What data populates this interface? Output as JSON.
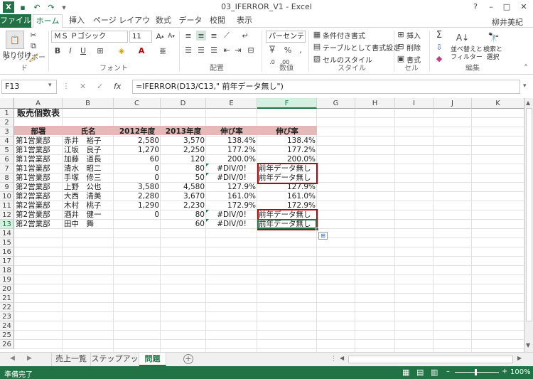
{
  "window": {
    "title": "03_IFERROR_V1 - Excel",
    "user": "柳井美紀"
  },
  "qat": {
    "save": "💾",
    "undo": "↶",
    "redo": "↷"
  },
  "tabs": [
    "ファイル",
    "ホーム",
    "挿入",
    "ページ レイアウト",
    "数式",
    "データ",
    "校閲",
    "表示"
  ],
  "ribbon": {
    "paste": "貼り付け",
    "clipboard_label": "クリップボード",
    "font_name": "ＭＳ Ｐゴシック",
    "font_size": "11",
    "font_label": "フォント",
    "align_label": "配置",
    "number_format": "パーセンテー",
    "number_label": "数値",
    "cond_format": "条件付き書式",
    "table_format": "テーブルとして書式設定",
    "cell_style": "セルのスタイル",
    "style_label": "スタイル",
    "insert": "挿入",
    "delete": "削除",
    "format": "書式",
    "cells_label": "セル",
    "sort_filter": "並べ替えと\nフィルター",
    "find_select": "検索と\n選択",
    "edit_label": "編集"
  },
  "formula_bar": {
    "name": "F13",
    "formula": "=IFERROR(D13/C13,\" 前年データ無し\")",
    "fx": "fx"
  },
  "columns": [
    "A",
    "B",
    "C",
    "D",
    "E",
    "F",
    "G",
    "H",
    "I",
    "J",
    "K"
  ],
  "rows": [
    "1",
    "2",
    "3",
    "4",
    "5",
    "6",
    "7",
    "8",
    "9",
    "10",
    "11",
    "12",
    "13",
    "14",
    "15",
    "16",
    "17",
    "18",
    "19",
    "20",
    "21",
    "22",
    "23",
    "24",
    "25",
    "26"
  ],
  "sheet_title": "販売個数表",
  "table_headers": [
    "部署",
    "氏名",
    "2012年度",
    "2013年度",
    "伸び率",
    "伸び率"
  ],
  "table_rows": [
    [
      "第1営業部",
      "赤井　裕子",
      "2,580",
      "3,570",
      "138.4%",
      "138.4%"
    ],
    [
      "第1営業部",
      "江坂　良子",
      "1,270",
      "2,250",
      "177.2%",
      "177.2%"
    ],
    [
      "第1営業部",
      "加藤　道長",
      "60",
      "120",
      "200.0%",
      "200.0%"
    ],
    [
      "第1営業部",
      "清水　昭二",
      "0",
      "80",
      "#DIV/0!",
      "前年データ無し"
    ],
    [
      "第1営業部",
      "手塚　修三",
      "0",
      "50",
      "#DIV/0!",
      "前年データ無し"
    ],
    [
      "第2営業部",
      "上野　公也",
      "3,580",
      "4,580",
      "127.9%",
      "127.9%"
    ],
    [
      "第2営業部",
      "大西　清美",
      "2,280",
      "3,670",
      "161.0%",
      "161.0%"
    ],
    [
      "第2営業部",
      "木村　桃子",
      "1,290",
      "2,230",
      "172.9%",
      "172.9%"
    ],
    [
      "第2営業部",
      "酒井　健一",
      "0",
      "80",
      "#DIV/0!",
      "前年データ無し"
    ],
    [
      "第2営業部",
      "田中　舞",
      "",
      "60",
      "#DIV/0!",
      "前年データ無し"
    ]
  ],
  "sheet_tabs": [
    "売上一覧",
    "ステップアップ",
    "問題"
  ],
  "status": {
    "ready": "準備完了",
    "zoom": "100%"
  },
  "colors": {
    "excel_green": "#217346",
    "header_fill": "#e6b8b8",
    "highlight_red": "#c00000"
  }
}
